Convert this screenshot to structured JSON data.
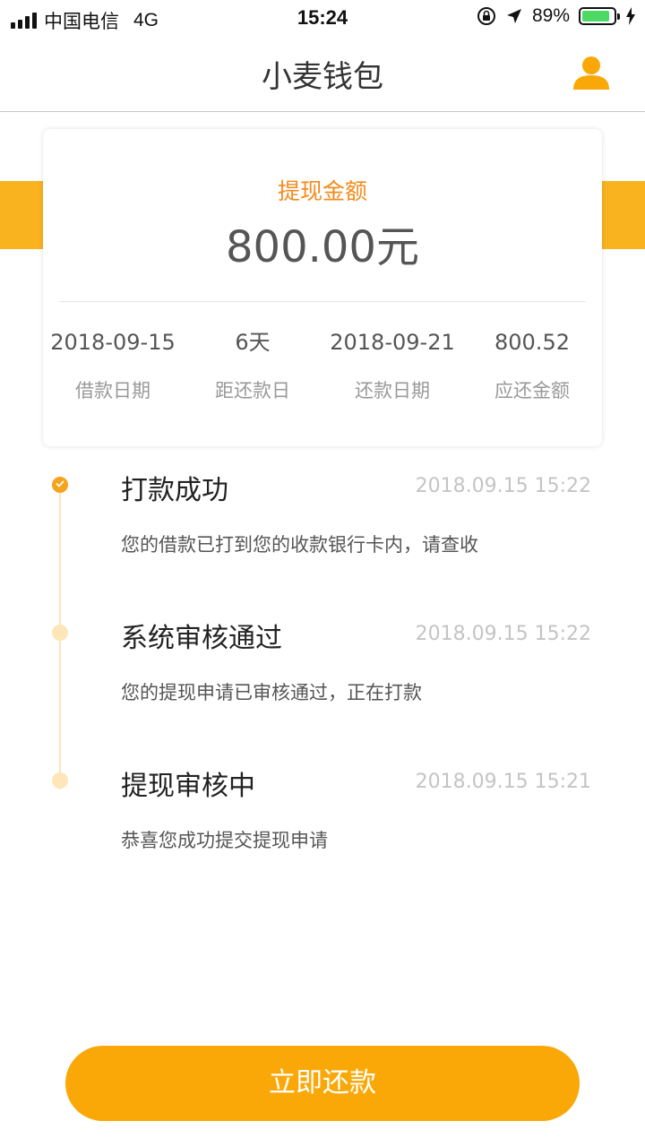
{
  "status_bar": {
    "carrier": "中国电信",
    "network": "4G",
    "time": "15:24",
    "battery_percent": "89%",
    "battery_level": 0.89,
    "icons": [
      "signal-icon",
      "orientation-lock-icon",
      "location-arrow-icon",
      "battery-icon",
      "charging-bolt-icon"
    ]
  },
  "header": {
    "title": "小麦钱包",
    "user_icon": "user-icon"
  },
  "summary": {
    "label": "提现金额",
    "amount": "800.00元",
    "stats": [
      {
        "value": "2018-09-15",
        "label": "借款日期"
      },
      {
        "value": "6天",
        "label": "距还款日"
      },
      {
        "value": "2018-09-21",
        "label": "还款日期"
      },
      {
        "value": "800.52",
        "label": "应还金额"
      }
    ]
  },
  "timeline": [
    {
      "title": "打款成功",
      "time": "2018.09.15 15:22",
      "desc": "您的借款已打到您的收款银行卡内，请查收",
      "active": true
    },
    {
      "title": "系统审核通过",
      "time": "2018.09.15 15:22",
      "desc": "您的提现申请已审核通过，正在打款",
      "active": false
    },
    {
      "title": "提现审核中",
      "time": "2018.09.15 15:21",
      "desc": "恭喜您成功提交提现申请",
      "active": false
    }
  ],
  "actions": {
    "repay_label": "立即还款"
  },
  "colors": {
    "accent": "#f9a808",
    "accent_light": "#fde6b8",
    "label_orange": "#f48b1b",
    "battery_green": "#4cd964"
  }
}
